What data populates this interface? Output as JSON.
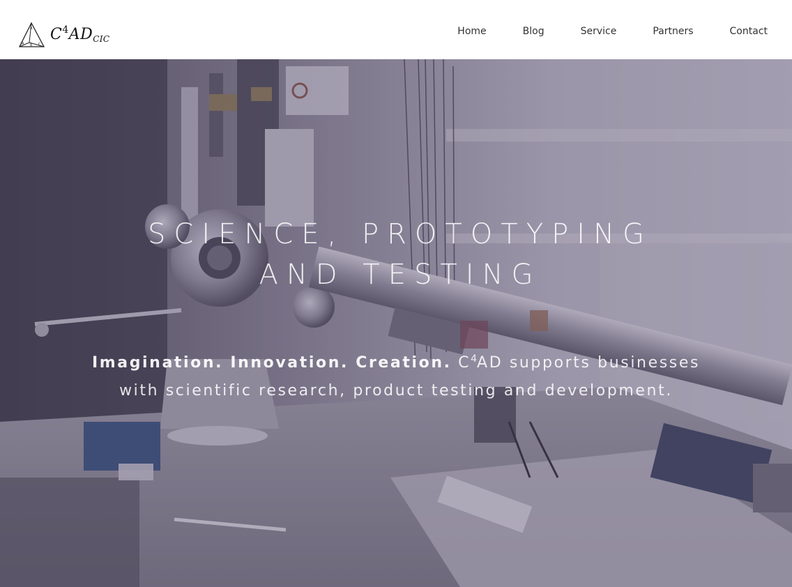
{
  "brand": {
    "logo_text": "C",
    "logo_sup": "4",
    "logo_text_2": "AD",
    "logo_sub": "CIC",
    "logo_icon": "pyramid-icon"
  },
  "nav": {
    "items": [
      {
        "label": "Home"
      },
      {
        "label": "Blog"
      },
      {
        "label": "Service"
      },
      {
        "label": "Partners"
      },
      {
        "label": "Contact"
      }
    ]
  },
  "hero": {
    "title": "SCIENCE, PROTOTYPING AND TESTING",
    "tagline_bold": "Imagination. Innovation. Creation.",
    "tagline_pre": "C",
    "tagline_sup": "4",
    "tagline_rest": "AD supports businesses with scientific research, product testing and development."
  },
  "colors": {
    "overlay": "#5a5270",
    "nav_text": "#333333",
    "header_bg": "#ffffff"
  }
}
